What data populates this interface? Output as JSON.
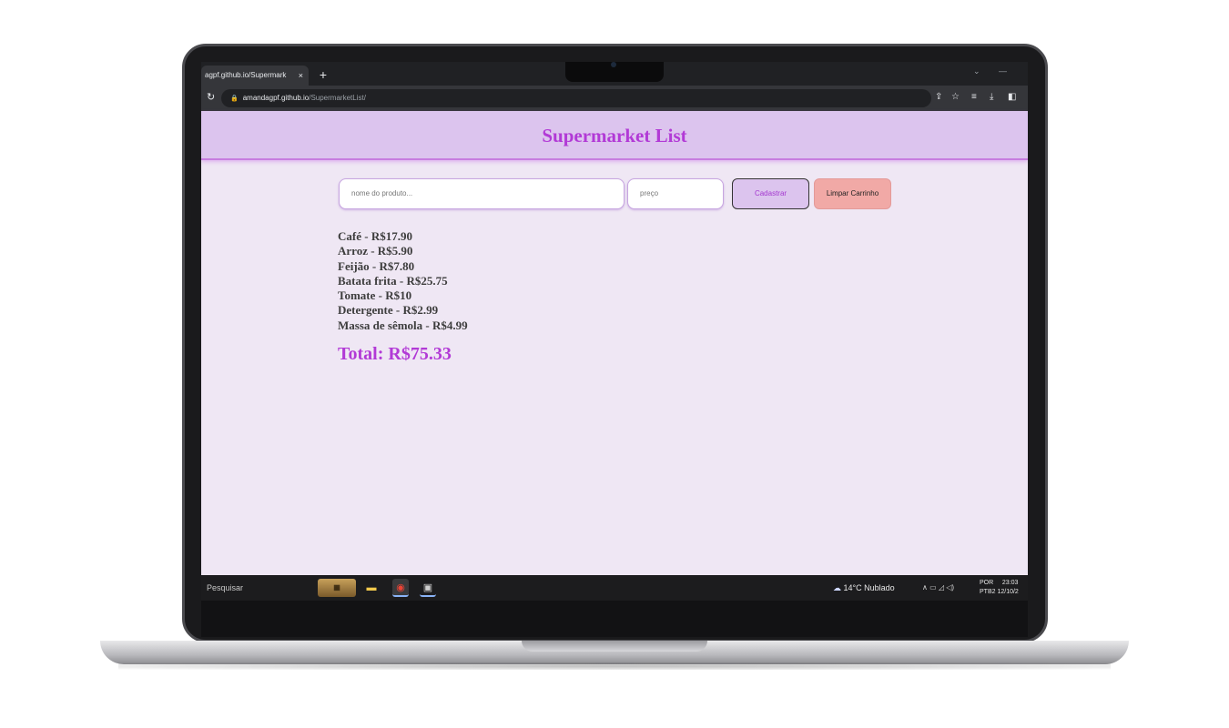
{
  "browser": {
    "tab_title": "agpf.github.io/Supermark",
    "tab_close": "×",
    "new_tab": "+",
    "url_host": "amandagpf.github.io",
    "url_path": "/SupermarketList/"
  },
  "page": {
    "title": "Supermarket List",
    "product_placeholder": "nome do produto...",
    "price_placeholder": "preço",
    "register_label": "Cadastrar",
    "clear_label": "Limpar Carrinho",
    "items": [
      "Café - R$17.90",
      "Arroz - R$5.90",
      "Feijão - R$7.80",
      "Batata frita - R$25.75",
      "Tomate - R$10",
      "Detergente - R$2.99",
      "Massa de sêmola - R$4.99"
    ],
    "total": "Total: R$75.33"
  },
  "taskbar": {
    "search_label": "Pesquisar",
    "weather": "14°C  Nublado",
    "language": "POR",
    "keyboard": "PTB2",
    "time": "23:03",
    "date": "12/10/2"
  },
  "colors": {
    "accent": "#b23ad6",
    "header_bg": "#dcc4ee",
    "page_bg": "#efe7f4",
    "clear_button": "#f1a9a6"
  }
}
